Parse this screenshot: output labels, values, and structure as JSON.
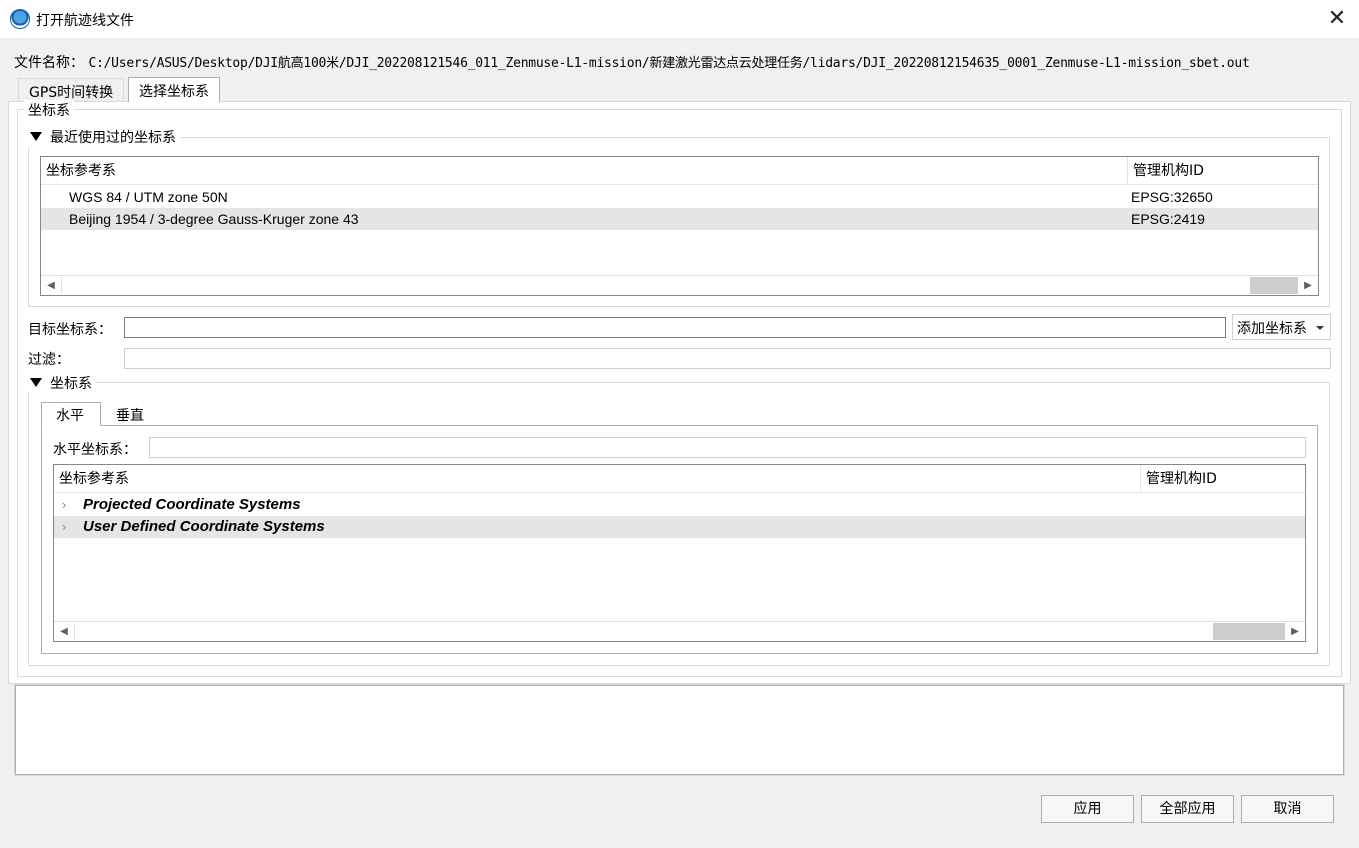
{
  "window": {
    "title": "打开航迹线文件",
    "close_glyph": "✕"
  },
  "file": {
    "label": "文件名称：",
    "path": "C:/Users/ASUS/Desktop/DJI航高100米/DJI_202208121546_011_Zenmuse-L1-mission/新建激光雷达点云处理任务/lidars/DJI_20220812154635_0001_Zenmuse-L1-mission_sbet.out"
  },
  "tabs": [
    {
      "label": "GPS时间转换",
      "active": false
    },
    {
      "label": "选择坐标系",
      "active": true
    }
  ],
  "crs_group": {
    "title": "坐标系",
    "recent": {
      "title": "最近使用过的坐标系",
      "columns": [
        "坐标参考系",
        "管理机构ID"
      ],
      "rows": [
        {
          "name": "WGS 84 / UTM zone 50N",
          "id": "EPSG:32650",
          "selected": false
        },
        {
          "name": "Beijing 1954 / 3-degree Gauss-Kruger zone 43",
          "id": "EPSG:2419",
          "selected": true
        }
      ]
    },
    "target": {
      "label": "目标坐标系：",
      "value": "",
      "add_button": "添加坐标系"
    },
    "filter": {
      "label": "过滤：",
      "value": ""
    },
    "systems": {
      "title": "坐标系",
      "tabs": [
        {
          "label": "水平",
          "active": true
        },
        {
          "label": "垂直",
          "active": false
        }
      ],
      "horizontal_label": "水平坐标系：",
      "horizontal_value": "",
      "columns": [
        "坐标参考系",
        "管理机构ID"
      ],
      "tree": [
        {
          "label": "Projected Coordinate Systems",
          "selected": false
        },
        {
          "label": "User Defined Coordinate Systems",
          "selected": true
        }
      ]
    }
  },
  "buttons": {
    "apply": "应用",
    "apply_all": "全部应用",
    "cancel": "取消"
  },
  "scroll": {
    "left_arrow": "◀",
    "right_arrow": "▶",
    "chevron": "›"
  }
}
